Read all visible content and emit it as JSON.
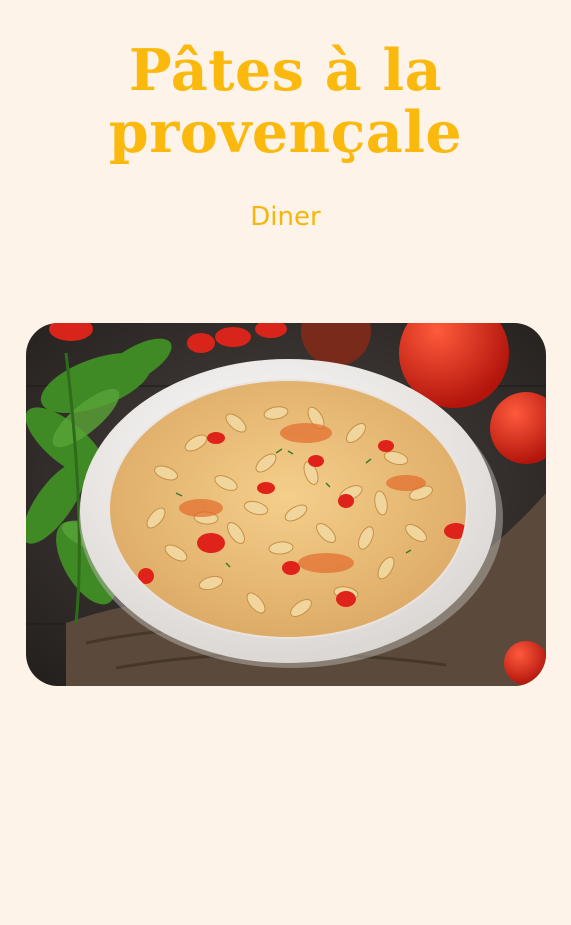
{
  "recipe": {
    "title": "Pâtes à la provençale",
    "category": "Diner"
  },
  "photo": {
    "subject": "bowl of orzo pasta with tomatoes and basil"
  },
  "colors": {
    "background": "#fdf3e8",
    "accent": "#fbb90d"
  }
}
